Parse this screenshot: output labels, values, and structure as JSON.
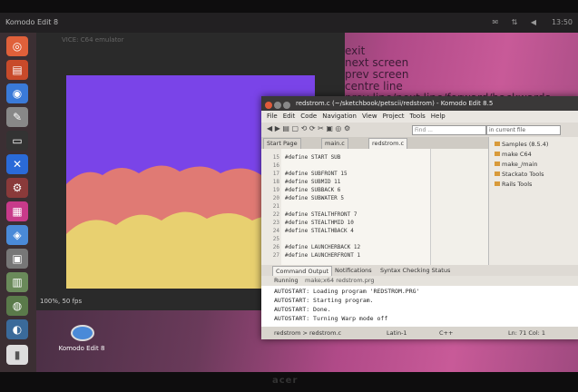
{
  "topbar": {
    "title": "Komodo Edit 8",
    "clock": "13:50"
  },
  "launcher": {
    "icons": [
      "ubuntu-home-icon",
      "files-icon",
      "firefox-icon",
      "text-editor-icon",
      "terminal-icon",
      "tools-icon",
      "gear-icon",
      "software-icon",
      "settings-icon",
      "disk-icon",
      "komodo-icon",
      "workspace-icon",
      "trash-icon",
      "apps-icon"
    ]
  },
  "background_text": [
    "exit",
    "next screen",
    "prev screen",
    "centre line",
    "prev line/next line/forward/backwards"
  ],
  "vice": {
    "title": "VICE: C64 emulator",
    "status": "100%, 50 fps"
  },
  "komodo": {
    "title": "redstrom.c (~/sketchbook/petscii/redstrom) - Komodo Edit 8.5",
    "menu": [
      "File",
      "Edit",
      "Code",
      "Navigation",
      "View",
      "Project",
      "Tools",
      "Help"
    ],
    "find_placeholder": "Find ...",
    "find_scope": "in current file",
    "tabs": [
      "Start Page",
      "main.c",
      "redstrom.c"
    ],
    "lines": [
      {
        "n": "15",
        "code": "#define START SUB"
      },
      {
        "n": "16",
        "code": ""
      },
      {
        "n": "17",
        "code": "#define SUBFRONT 15"
      },
      {
        "n": "18",
        "code": "#define SUBMID 11"
      },
      {
        "n": "19",
        "code": "#define SUBBACK 6"
      },
      {
        "n": "20",
        "code": "#define SUBWATER 5"
      },
      {
        "n": "21",
        "code": ""
      },
      {
        "n": "22",
        "code": "#define STEALTHFRONT 7"
      },
      {
        "n": "23",
        "code": "#define STEALTHMID 10"
      },
      {
        "n": "24",
        "code": "#define STEALTHBACK 4"
      },
      {
        "n": "25",
        "code": ""
      },
      {
        "n": "26",
        "code": "#define LAUNCHERBACK 12"
      },
      {
        "n": "27",
        "code": "#define LAUNCHERFRONT 1"
      }
    ],
    "places": [
      "Samples (8.5.4)",
      "make C64",
      "make_/main",
      "Stackato Tools",
      "Rails Tools"
    ],
    "output_tabs": [
      "Command Output",
      "Notifications",
      "Syntax Checking Status"
    ],
    "running_label": "Running",
    "running_cmd": "make;x64 redstrom.prg",
    "output_lines": [
      "AUTOSTART: Loading program 'REDSTROM.PRG'",
      "AUTOSTART: Starting program.",
      "AUTOSTART: Done.",
      "AUTOSTART: Turning Warp mode off"
    ],
    "status": {
      "breadcrumb": "redstrom > redstrom.c",
      "encoding": "Latin-1",
      "language": "C++",
      "position": "Ln: 71 Col: 1"
    }
  },
  "desktop_icon": {
    "label": "Komodo Edit 8"
  },
  "bezel": {
    "brand": "acer"
  },
  "colors": {
    "c64_sky": "#7a44e8",
    "c64_cloud": "#e07a74",
    "c64_ground": "#e8d070"
  }
}
